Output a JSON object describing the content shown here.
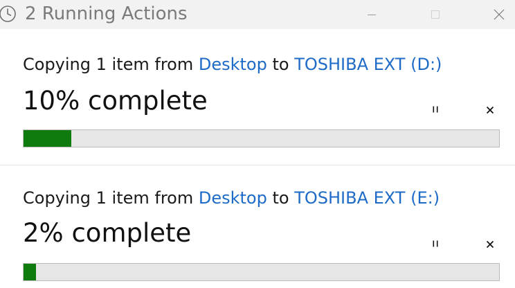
{
  "window": {
    "title": "2 Running Actions",
    "icon": "clock-icon"
  },
  "actions": [
    {
      "prefix": "Copying 1 item from ",
      "source": "Desktop",
      "mid": " to ",
      "destination": "TOSHIBA EXT (D:)",
      "progress_text": "10% complete",
      "progress": 0.1,
      "bar_color": "#0f7b0f"
    },
    {
      "prefix": "Copying 1 item from ",
      "source": "Desktop",
      "mid": " to ",
      "destination": "TOSHIBA EXT (E:)",
      "progress_text": "2% complete",
      "progress": 0.026,
      "bar_color": "#0f7b0f"
    }
  ],
  "colors": {
    "link": "#1e6bc7",
    "titlebar": "#f2f2f2",
    "progress_track": "#e6e6e6"
  }
}
